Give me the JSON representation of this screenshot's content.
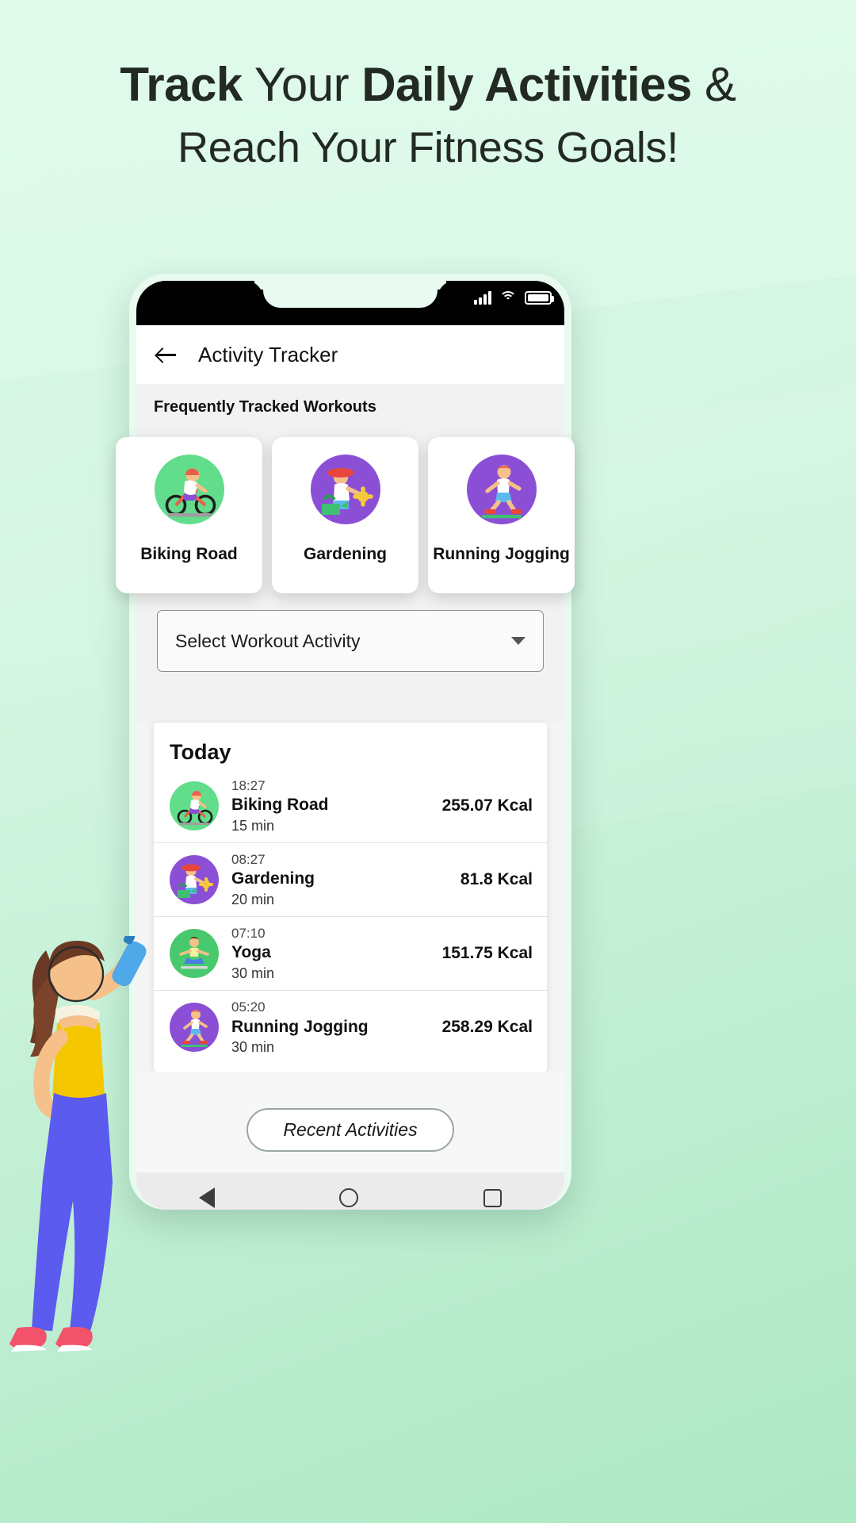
{
  "hero": {
    "line1_bold1": "Track",
    "line1_normal": "Your",
    "line1_bold2": "Daily Activities",
    "line1_amp": "&",
    "line2": "Reach Your Fitness Goals!"
  },
  "statusbar": {
    "signal_icon": "cellular-signal-icon",
    "wifi_icon": "wifi-icon",
    "battery_icon": "battery-full-icon"
  },
  "appbar": {
    "back_icon": "back-arrow-icon",
    "title": "Activity Tracker"
  },
  "frequent": {
    "section_title": "Frequently Tracked Workouts",
    "cards": [
      {
        "label": "Biking Road",
        "icon": "cyclist-icon",
        "circle_color": "#62dd8b"
      },
      {
        "label": "Gardening",
        "icon": "gardener-icon",
        "circle_color": "#8b4fd6"
      },
      {
        "label": "Running Jogging",
        "icon": "runner-icon",
        "circle_color": "#8b4fd6"
      }
    ]
  },
  "selector": {
    "value": "Select Workout Activity",
    "caret_icon": "chevron-down-icon"
  },
  "today": {
    "title": "Today",
    "rows": [
      {
        "time": "18:27",
        "name": "Biking Road",
        "duration": "15 min",
        "kcal": "255.07 Kcal",
        "icon": "cyclist-icon",
        "circle_color": "#62dd8b"
      },
      {
        "time": "08:27",
        "name": "Gardening",
        "duration": "20 min",
        "kcal": "81.8 Kcal",
        "icon": "gardener-icon",
        "circle_color": "#8b4fd6"
      },
      {
        "time": "07:10",
        "name": "Yoga",
        "duration": "30 min",
        "kcal": "151.75 Kcal",
        "icon": "yoga-icon",
        "circle_color": "#49c96d"
      },
      {
        "time": "05:20",
        "name": "Running Jogging",
        "duration": "30 min",
        "kcal": "258.29 Kcal",
        "icon": "runner-icon",
        "circle_color": "#8b4fd6"
      }
    ]
  },
  "footer": {
    "recent_button": "Recent Activities"
  },
  "navbar": {
    "back_icon": "nav-back-triangle-icon",
    "home_icon": "nav-home-circle-icon",
    "recents_icon": "nav-recents-square-icon"
  },
  "decor": {
    "woman_illustration": "woman-drinking-water-illustration"
  },
  "colors": {
    "background_mint": "#d4f6e2",
    "accent_green": "#62dd8b",
    "accent_purple": "#8b4fd6",
    "text_dark": "#111111"
  }
}
